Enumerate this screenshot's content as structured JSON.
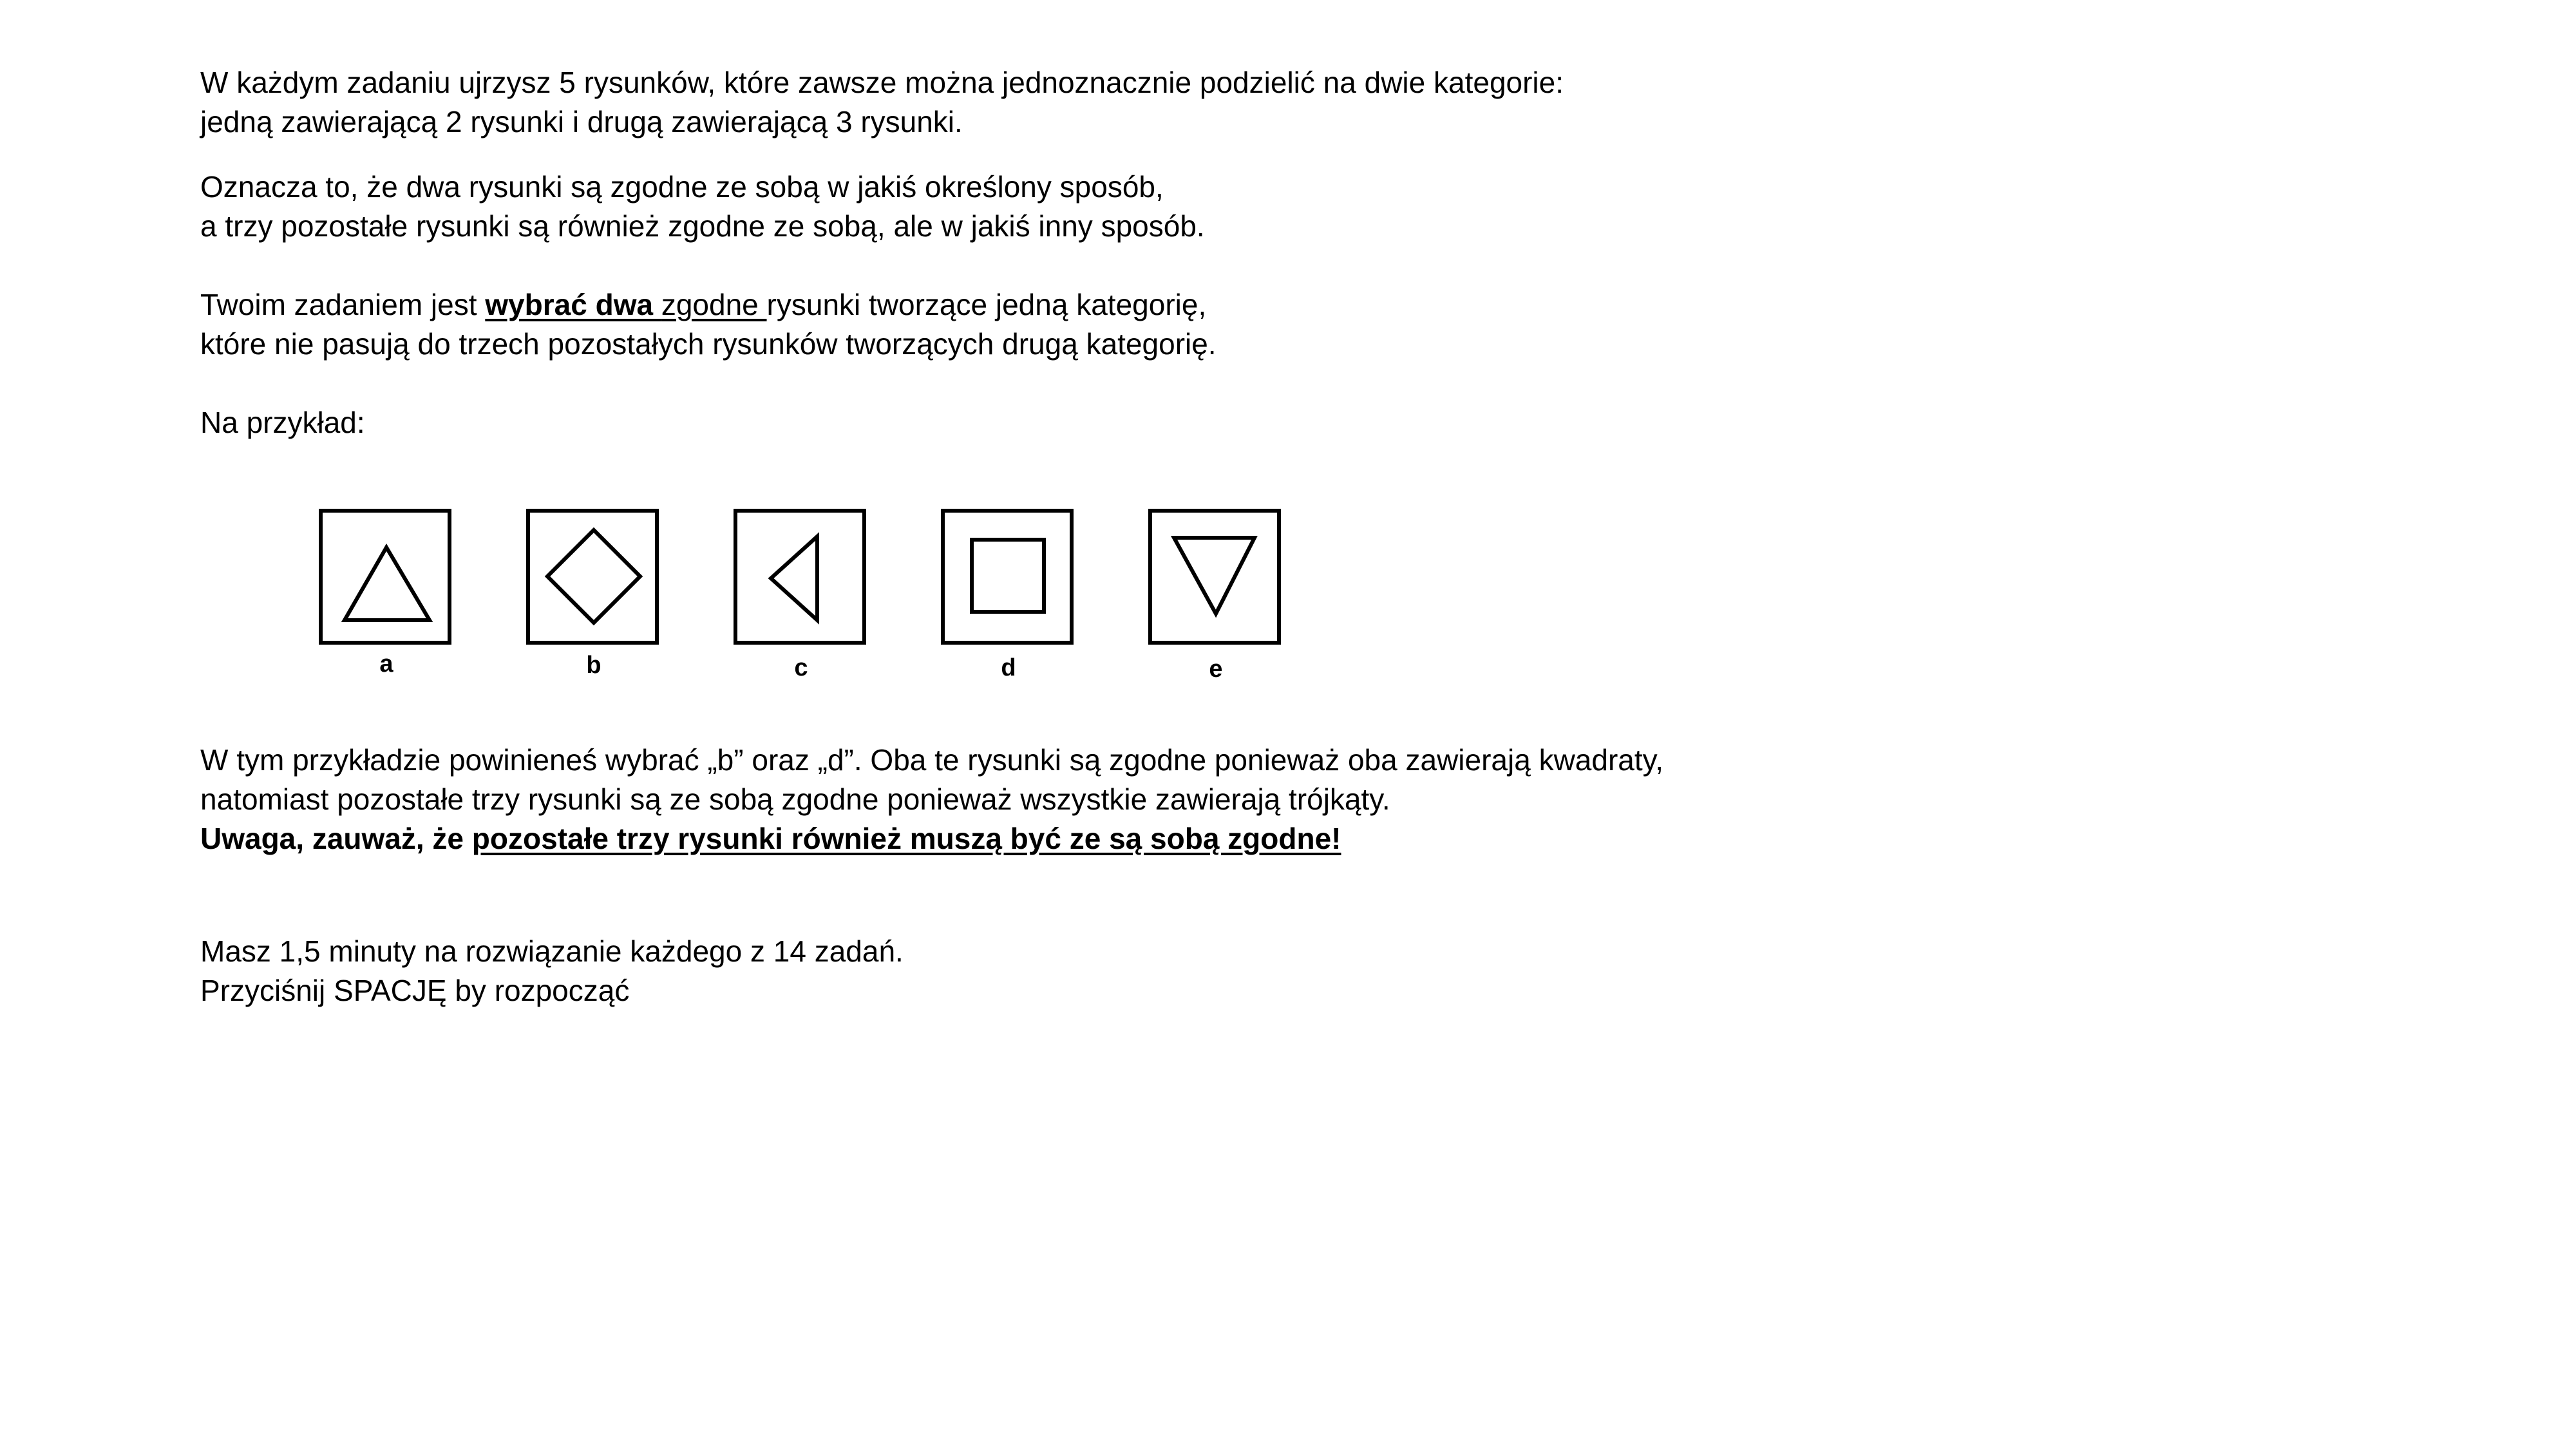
{
  "intro": {
    "line1": "W każdym zadaniu ujrzysz 5 rysunków, które zawsze można jednoznacznie podzielić na dwie kategorie:",
    "line2": "jedną zawierającą 2 rysunki i drugą zawierającą 3 rysunki."
  },
  "meaning": {
    "line1": "Oznacza to, że dwa rysunki są zgodne ze sobą w jakiś określony sposób,",
    "line2": "a trzy pozostałe rysunki są również zgodne ze sobą, ale w jakiś inny sposób."
  },
  "task": {
    "line1_pre": "Twoim zadaniem jest ",
    "line1_bold": "wybrać dwa ",
    "line1_underlined": "zgodne ",
    "line1_post": "rysunki tworzące jedną kategorię,",
    "line2": "które nie pasują do trzech pozostałych rysunków tworzących drugą kategorię."
  },
  "example_label": "Na przykład:",
  "figures": [
    {
      "label": "a",
      "shape": "triangle-up-icon"
    },
    {
      "label": "b",
      "shape": "diamond-icon"
    },
    {
      "label": "c",
      "shape": "triangle-left-icon"
    },
    {
      "label": "d",
      "shape": "square-icon"
    },
    {
      "label": "e",
      "shape": "triangle-down-icon"
    }
  ],
  "explanation": {
    "line1": "W tym przykładzie powinieneś wybrać „b” oraz „d”. Oba te rysunki są zgodne ponieważ oba zawierają kwadraty,",
    "line2": "natomiast pozostałe trzy rysunki są ze sobą zgodne ponieważ wszystkie zawierają trójkąty.",
    "line3_bold": "Uwaga, zauważ, że ",
    "line3_bold_underlined": "pozostałe trzy rysunki również muszą być ze są sobą zgodne!"
  },
  "footer": {
    "line1": "Masz 1,5 minuty na rozwiązanie każdego z 14 zadań.",
    "line2": "Przyciśnij SPACJĘ by rozpocząć"
  }
}
